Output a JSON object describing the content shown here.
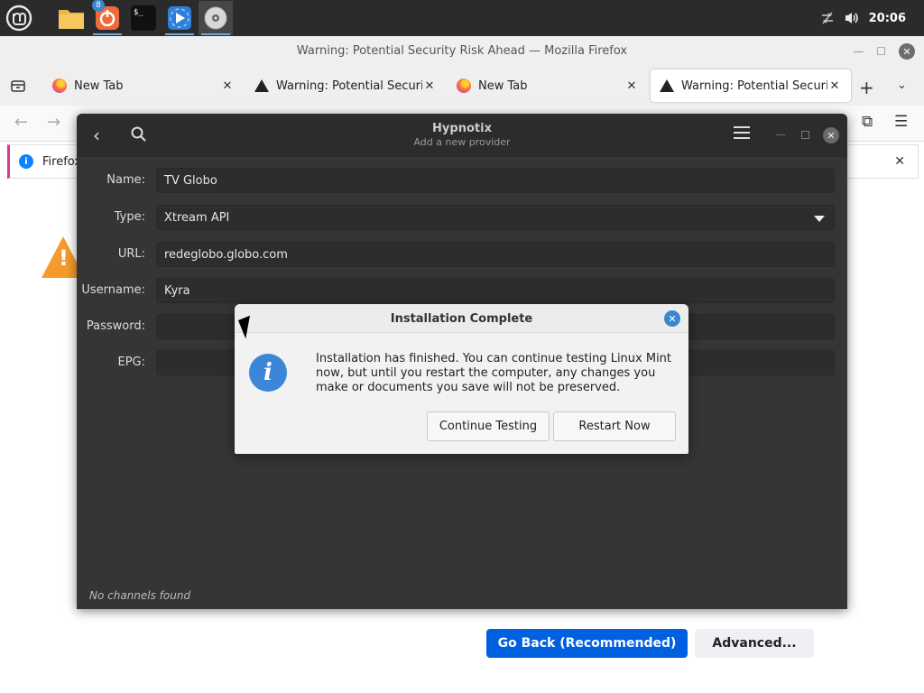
{
  "taskbar": {
    "apps": [
      {
        "name": "Linux Mint Menu",
        "icon": "mint-logo-icon"
      },
      {
        "name": "Files",
        "icon": "folder-icon"
      },
      {
        "name": "Software Updater",
        "icon": "update-manager-icon",
        "badge": "8"
      },
      {
        "name": "Terminal",
        "icon": "terminal-icon",
        "glyph": "$_"
      },
      {
        "name": "Hypnotix",
        "icon": "hypnotix-icon"
      },
      {
        "name": "Install Linux Mint",
        "icon": "disc-icon"
      }
    ],
    "clock": "20:06"
  },
  "firefox": {
    "window_title": "Warning: Potential Security Risk Ahead — Mozilla Firefox",
    "tabs": [
      {
        "label": "New Tab",
        "active": false
      },
      {
        "label": "Warning: Potential Security Risk Ahead",
        "active": false
      },
      {
        "label": "New Tab",
        "active": false
      },
      {
        "label": "Warning: Potential Security Risk Ahead",
        "active": true
      }
    ],
    "notification_text": "Firefox",
    "go_back_label": "Go Back (Recommended)",
    "advanced_label": "Advanced..."
  },
  "hypnotix": {
    "title": "Hypnotix",
    "subtitle": "Add a new provider",
    "fields": {
      "name_label": "Name:",
      "name_value": "TV Globo",
      "type_label": "Type:",
      "type_value": "Xtream API",
      "url_label": "URL:",
      "url_value": "redeglobo.globo.com",
      "username_label": "Username:",
      "username_value": "Kyra",
      "password_label": "Password:",
      "password_value": "",
      "epg_label": "EPG:",
      "epg_value": ""
    },
    "status": "No channels found"
  },
  "dialog": {
    "title": "Installation Complete",
    "message": "Installation has finished.  You can continue testing Linux Mint now, but until you restart the computer, any changes you make or documents you save will not be preserved.",
    "continue_label": "Continue Testing",
    "restart_label": "Restart Now"
  },
  "colors": {
    "taskbar_bg": "#2b2b2b",
    "accent_blue": "#0061e0",
    "dialog_icon": "#3b86d6",
    "hypnotix_bg": "#353535"
  }
}
